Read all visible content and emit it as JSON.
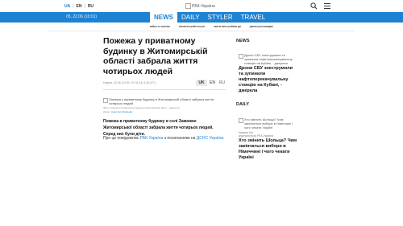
{
  "header": {
    "languages": [
      "UA",
      "EN",
      "RU"
    ],
    "active_language": "UA",
    "logo_text": "РБК-Україна",
    "search_icon": "search-icon",
    "menu_icon": "hamburger-icon"
  },
  "nav": {
    "date": "05, 22.06 (10:01)",
    "tabs": [
      "NEWS",
      "DAILY",
      "STYLER",
      "TRAVEL"
    ],
    "active_tab": "NEWS",
    "sublinks": [
      "ВІЙНА В УКРАЇНІ",
      "УКРАЇНСЬКИЙ КАНАЛ",
      "ЗВІТИ ПРО БОЙОВІ ДІЇ",
      "ДОКЛАД РОЗВІДКИ"
    ]
  },
  "article": {
    "title": "Пожежа у приватному будинку в Житомирській області забрала життя чотирьох людей",
    "meta": "Неділя, 22.06 (12:30, 07.03.24) 1:30 (УТ)",
    "lang_switch": [
      "UK",
      "EN",
      "RU"
    ],
    "image_caption": "Пожежа у приватному будинку в Житомирській області забрала життя чотирьох людей",
    "photo_credit": "Фото: пожежа в приватному будинку (ілюстративне фото - джерело)",
    "author_label": "Автор:",
    "author_link": "Анастасія Зайцева",
    "lead": "Пожежа в приватному будинку в селі Заможне Житомирської області забрала життя чотирьох людей. Серед них були діти.",
    "body_prefix": "Про це повідомляє",
    "body_link1": "РБК-Україна",
    "body_middle": "з посиланням на",
    "body_link2": "ДСНС України."
  },
  "sidebar": {
    "news_heading": "NEWS",
    "news_card": {
      "image_alt": "Дрони СБУ знеструмили та зупинили нафтоперекачувальну станцію на Кубані, - джерела",
      "title": "Дрони СБУ знеструмили та зупинили нафтоперекачувальну станцію на Кубані, - джерела"
    },
    "daily_heading": "DAILY",
    "daily_card": {
      "image_alt": "Хто змінить Шольца? Чим закінчаться вибори в Німеччині і чого чекати Україні",
      "meta": "Новини Кіл",
      "author": "журналіст(ка) РБК-Україна",
      "title": "Хто змінить Шольца? Чим закінчаться вибори в Німеччині і чого чекати Україні"
    }
  },
  "colors": {
    "accent": "#1e82d2",
    "text": "#222222"
  }
}
